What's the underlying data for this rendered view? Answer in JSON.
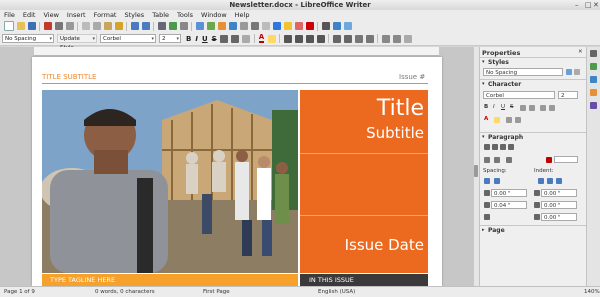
{
  "window": {
    "title": "Newsletter.docx - LibreOffice Writer"
  },
  "menu": [
    "File",
    "Edit",
    "View",
    "Insert",
    "Format",
    "Styles",
    "Table",
    "Tools",
    "Window",
    "Help"
  ],
  "formatting": {
    "paragraph_style": "No Spacing",
    "update_style": "Update Style",
    "font_name": "Corbel",
    "font_size": "2",
    "bold": "B",
    "italic": "I",
    "underline": "U",
    "strike": "S",
    "font_color_letter": "A"
  },
  "document": {
    "title_subtitle": "TITLE SUBTITLE",
    "issue_number": "Issue #",
    "panel_title": "Title",
    "panel_subtitle": "Subtitle",
    "issue_date": "Issue Date",
    "tagline": "TYPE TAGLINE HERE",
    "in_this_issue": "IN THIS ISSUE"
  },
  "sidebar": {
    "header": "Properties",
    "styles_section": "Styles",
    "style_value": "No Spacing",
    "character_section": "Character",
    "char_font": "Corbel",
    "char_size": "2",
    "paragraph_section": "Paragraph",
    "spacing_label": "Spacing:",
    "indent_label": "Indent:",
    "spacing_above": "0.00 \"",
    "spacing_below": "0.04 \"",
    "indent_before": "0.00 \"",
    "indent_after": "0.00 \"",
    "indent_first": "0.00 \"",
    "page_section": "Page"
  },
  "status": {
    "page": "Page 1 of 9",
    "words": "0 words, 0 characters",
    "page_style": "First Page",
    "language": "English (USA)",
    "zoom": "140%"
  },
  "colors": {
    "accent_orange": "#ec6a1f",
    "tagline_orange": "#f5a12b",
    "dark_band": "#3a3a3a"
  }
}
